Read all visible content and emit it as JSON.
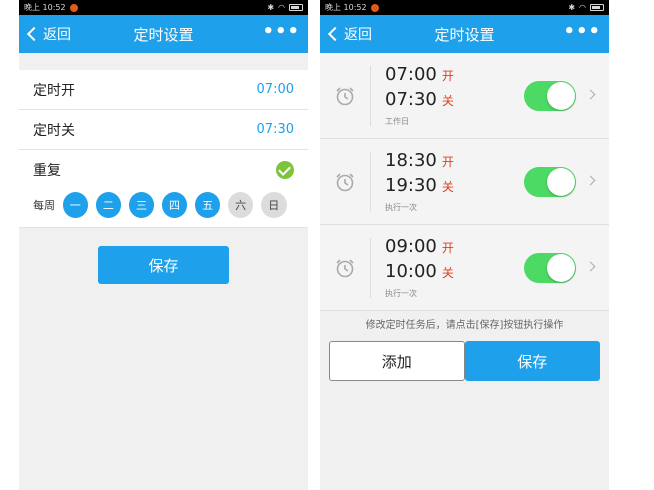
{
  "status_bar": {
    "carrier": "晚上 10:52"
  },
  "left": {
    "nav": {
      "back": "返回",
      "title": "定时设置"
    },
    "rows": [
      {
        "label": "定时开",
        "value": "07:00"
      },
      {
        "label": "定时关",
        "value": "07:30"
      }
    ],
    "repeat": {
      "label": "重复",
      "week_label": "每周",
      "days": [
        {
          "label": "一",
          "selected": true
        },
        {
          "label": "二",
          "selected": true
        },
        {
          "label": "三",
          "selected": true
        },
        {
          "label": "四",
          "selected": true
        },
        {
          "label": "五",
          "selected": true
        },
        {
          "label": "六",
          "selected": false
        },
        {
          "label": "日",
          "selected": false
        }
      ]
    },
    "save": "保存"
  },
  "right": {
    "nav": {
      "back": "返回",
      "title": "定时设置"
    },
    "timers": [
      {
        "on_time": "07:00",
        "on_tag": "开",
        "off_time": "07:30",
        "off_tag": "关",
        "repeat": "工作日",
        "enabled": true
      },
      {
        "on_time": "18:30",
        "on_tag": "开",
        "off_time": "19:30",
        "off_tag": "关",
        "repeat": "执行一次",
        "enabled": true
      },
      {
        "on_time": "09:00",
        "on_tag": "开",
        "off_time": "10:00",
        "off_tag": "关",
        "repeat": "执行一次",
        "enabled": true
      }
    ],
    "hint": "修改定时任务后，请点击[保存]按钮执行操作",
    "add": "添加",
    "save": "保存"
  },
  "colors": {
    "accent": "#1ea0ea",
    "toggle_on": "#4cd964",
    "tag": "#e04020",
    "check": "#7dc43a"
  },
  "icons": [
    "back-chevron-icon",
    "more-icon",
    "check-icon",
    "alarm-clock-icon",
    "chevron-right-icon",
    "bluetooth-icon",
    "wifi-icon",
    "battery-icon"
  ]
}
